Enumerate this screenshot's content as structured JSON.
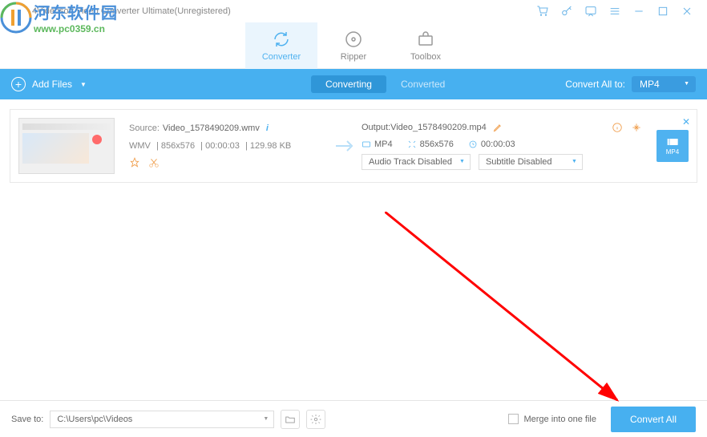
{
  "titlebar": {
    "title": "4Videosoft Video Converter Ultimate(Unregistered)"
  },
  "watermark": {
    "cn": "河东软件园",
    "url": "www.pc0359.cn"
  },
  "main_tabs": {
    "converter": "Converter",
    "ripper": "Ripper",
    "toolbox": "Toolbox"
  },
  "toolbar": {
    "add_files": "Add Files",
    "sub_tabs": {
      "converting": "Converting",
      "converted": "Converted"
    },
    "convert_all_to": "Convert All to:",
    "format": "MP4"
  },
  "file": {
    "source_label": "Source:",
    "source_name": "Video_1578490209.wmv",
    "meta": {
      "fmt": "WMV",
      "res": "856x576",
      "dur": "00:00:03",
      "size": "129.98 KB"
    },
    "output_label": "Output:",
    "output_name": "Video_1578490209.mp4",
    "out": {
      "fmt": "MP4",
      "res": "856x576",
      "dur": "00:00:03"
    },
    "audio_track": "Audio Track Disabled",
    "subtitle": "Subtitle Disabled",
    "badge": "MP4"
  },
  "bottom": {
    "save_to_label": "Save to:",
    "save_to_path": "C:\\Users\\pc\\Videos",
    "merge": "Merge into one file",
    "convert_all": "Convert All"
  }
}
